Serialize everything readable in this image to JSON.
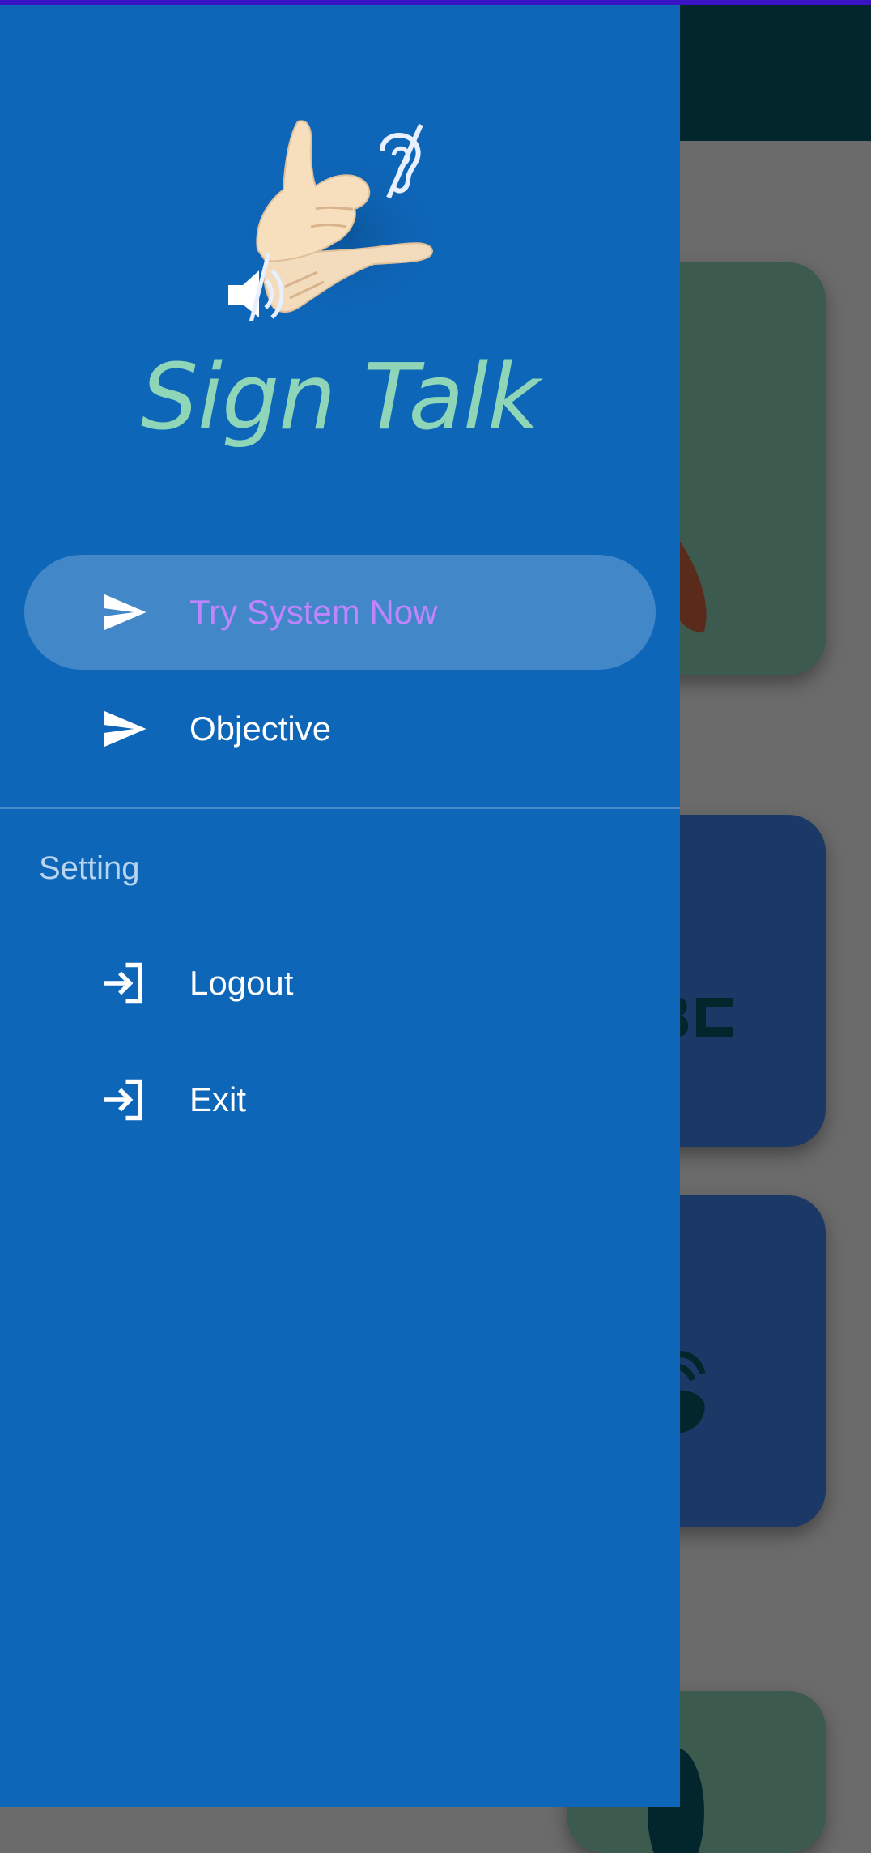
{
  "drawer": {
    "app_name": "Sign Talk",
    "logo_icon": "sign-language-hand-logo",
    "menu": [
      {
        "label": "Try System Now",
        "icon": "send-icon",
        "active": true
      },
      {
        "label": "Objective",
        "icon": "send-icon",
        "active": false
      }
    ],
    "settings_section": {
      "header": "Setting",
      "items": [
        {
          "label": "Logout",
          "icon": "login-icon"
        },
        {
          "label": "Exit",
          "icon": "login-icon"
        }
      ]
    }
  },
  "colors": {
    "drawer_background": "#0e66b8",
    "active_item_text": "#c084fc",
    "app_name": "#8fd6b8",
    "status_strip": "#3a13c4",
    "scrim": "#6b6b6b"
  }
}
